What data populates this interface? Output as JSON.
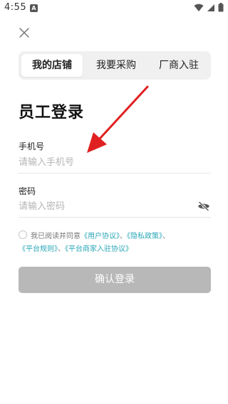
{
  "status_bar": {
    "time": "4:55",
    "notification_badge": "A",
    "icons": [
      "wifi-icon",
      "signal-icon",
      "battery-icon"
    ]
  },
  "close": {
    "icon": "close-icon"
  },
  "tabs": [
    {
      "label": "我的店铺",
      "active": true
    },
    {
      "label": "我要采购",
      "active": false
    },
    {
      "label": "厂商入驻",
      "active": false
    }
  ],
  "page_title": "员工登录",
  "phone": {
    "label": "手机号",
    "placeholder": "请输入手机号",
    "value": ""
  },
  "password": {
    "label": "密码",
    "placeholder": "请输入密码",
    "value": "",
    "toggle_icon": "eye-off-icon"
  },
  "agreement": {
    "prefix": "我已阅读并同意",
    "link_user": "《用户协议》",
    "sep1": "、",
    "link_privacy": "《隐私政策》",
    "sep2": "、",
    "link_rules": "《平台规则》",
    "sep3": "、",
    "link_merchant": "《平台商家入驻协议》",
    "checked": false
  },
  "login_button": "确认登录",
  "colors": {
    "accent_link": "#2aa7b8",
    "button_disabled": "#b8b8b8",
    "tab_background": "#f0f0f0",
    "annotation_arrow": "#e02020"
  }
}
